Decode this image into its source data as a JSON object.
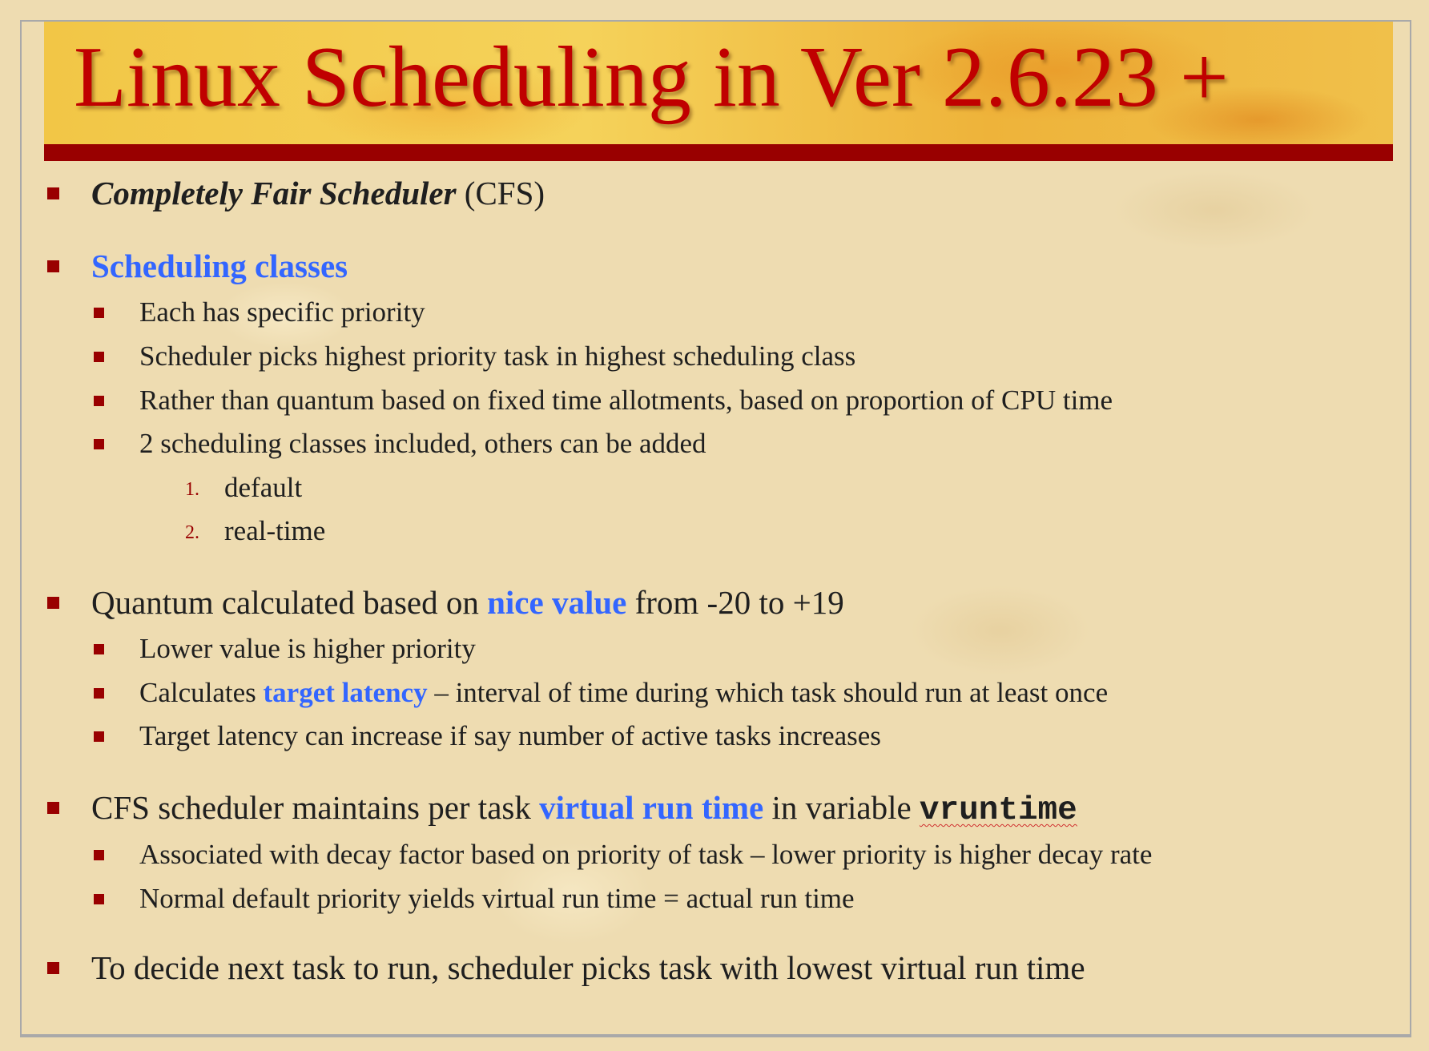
{
  "title": "Linux Scheduling in Ver 2.6.23 +",
  "colors": {
    "accent_red": "#990000",
    "title_red": "#c00000",
    "highlight_blue": "#3366ff"
  },
  "bullets": {
    "cfs": {
      "italic": "Completely Fair Scheduler",
      "rest": " (CFS)"
    },
    "classes": {
      "label": "Scheduling classes",
      "items": [
        "Each has specific priority",
        "Scheduler picks highest priority task in highest scheduling class",
        "Rather than quantum based on fixed time allotments, based on proportion of CPU time",
        "2 scheduling classes included, others can be added"
      ],
      "numbered": [
        {
          "num": "1.",
          "text": "default"
        },
        {
          "num": "2.",
          "text": "real-time"
        }
      ]
    },
    "quantum": {
      "pre": "Quantum calculated based on ",
      "hl": "nice value",
      "post": " from -20 to +19",
      "items": {
        "lower": "Lower value is higher priority",
        "calc_pre": "Calculates ",
        "calc_hl": "target latency",
        "calc_post": " – interval of time during which task should run at least once",
        "target": "Target latency can increase if say number of active tasks increases"
      }
    },
    "vruntime": {
      "pre": "CFS scheduler maintains per task ",
      "hl": "virtual run time",
      "mid": " in variable ",
      "code": "vruntime",
      "items": [
        "Associated with decay factor based on priority of task – lower priority is higher decay rate",
        "Normal default priority yields virtual run time = actual run time"
      ]
    },
    "decide": "To decide next task to run, scheduler picks task with lowest virtual run time"
  }
}
